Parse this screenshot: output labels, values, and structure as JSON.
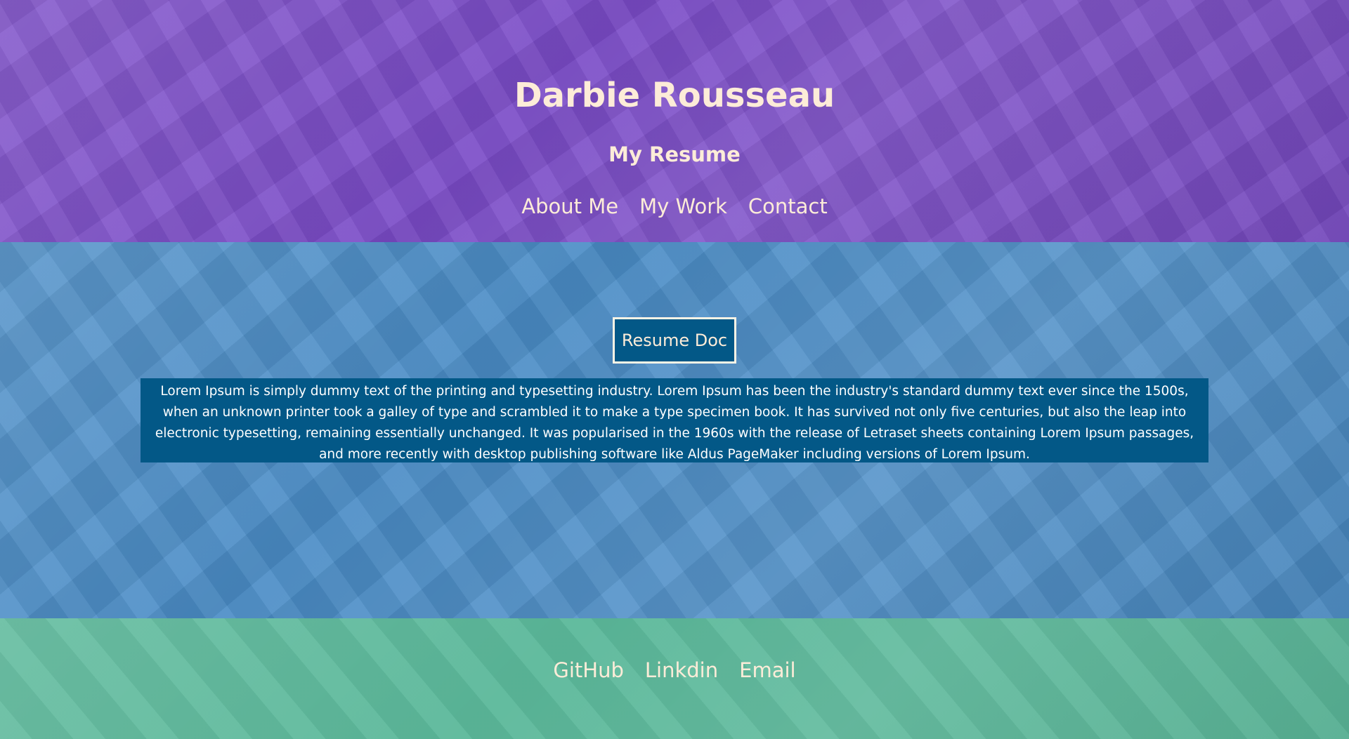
{
  "colors": {
    "header_bg": "#7a4bc7",
    "main_bg": "#4a8cc6",
    "footer_bg": "#5bb89a",
    "text_accent": "#fdecd8",
    "panel_bg": "#035887"
  },
  "header": {
    "title": "Darbie Rousseau",
    "subtitle": "My Resume",
    "nav": [
      {
        "label": "About Me"
      },
      {
        "label": "My Work"
      },
      {
        "label": "Contact"
      }
    ]
  },
  "main": {
    "resume_button_label": "Resume Doc",
    "about_text": "Lorem Ipsum is simply dummy text of the printing and typesetting industry. Lorem Ipsum has been the industry's standard dummy text ever since the 1500s, when an unknown printer took a galley of type and scrambled it to make a type specimen book. It has survived not only five centuries, but also the leap into electronic typesetting, remaining essentially unchanged. It was popularised in the 1960s with the release of Letraset sheets containing Lorem Ipsum passages, and more recently with desktop publishing software like Aldus PageMaker including versions of Lorem Ipsum."
  },
  "footer": {
    "links": [
      {
        "label": "GitHub"
      },
      {
        "label": "Linkdin"
      },
      {
        "label": "Email"
      }
    ]
  }
}
